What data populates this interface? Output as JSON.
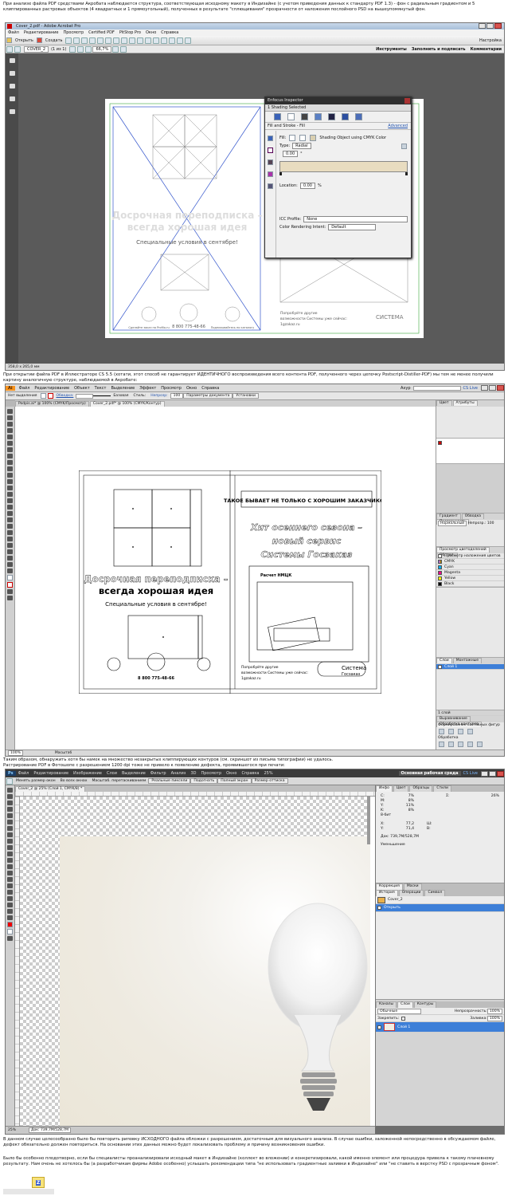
{
  "intro_text": "При анализе файла PDF средствами Акробата наблюдается структура, соответствующая исходному макету в Индизайне (с учетом приведения данных к стандарту PDF 1.3) - фон с радиальным градиентом и 5 клиппированных растровых объектов (4 квадратных и 1 прямоугольный), полученных в результате \"сплющивания\" прозрачности от наложения послойного PSD на вышеупомянутый фон.",
  "acrobat": {
    "title": "Cover_2.pdf - Adobe Acrobat Pro",
    "menu": [
      "Файл",
      "Редактирование",
      "Просмотр",
      "Certified PDF",
      "PitStop Pro",
      "Окно",
      "Справка"
    ],
    "toolbar": {
      "open": "Открыть",
      "create": "Создать",
      "settings": "Настройка"
    },
    "nav": {
      "page_field": "COVER_2",
      "page_count": "(1 из 1)",
      "zoom": "66,7%"
    },
    "right_tabs": [
      "Инструменты",
      "Заполнить и подписать",
      "Комментарии"
    ],
    "status": "358,0 x 265,0 мм",
    "doc": {
      "headline_1": "Досрочная переподписка –",
      "headline_2": "всегда хорошая идея",
      "subheadline": "Специальные условия в сентябре!",
      "site": "Сделайте заказ на Profilo.ru",
      "phone": "8 800 775-48-66",
      "phone_note": "Звонок на все бесплатно оформим",
      "subscription": "Подписывайтесь по каталогу",
      "right_text_1": "Попробуйте другие",
      "right_text_2": "возможности Системы уже сейчас:",
      "right_text_3": "1gzakaz.ru",
      "logo": "СИСТЕМА"
    },
    "inspector": {
      "title": "Enfocus Inspector",
      "selected": "1 Shading Selected",
      "section": "Fill and Stroke - Fill",
      "advanced": "Advanced",
      "fill_label": "Fill:",
      "shading_label": "Shading Object using CMYK Color",
      "type_label": "Type:",
      "type_value": "Radial",
      "angle_value": "0.00",
      "angle_unit": "°",
      "location_label": "Location:",
      "location_value": "0.00",
      "location_unit": "%",
      "icc_label": "ICC Profile:",
      "icc_value": "None",
      "intent_label": "Color Rendering Intent:",
      "intent_value": "Default"
    }
  },
  "illustrator_text": "При открытии файла PDF в Иллюстраторе CS 5.5 (хотати, этот способ не гарантирует ИДЕНТИЧНОГО воспроизведения всего контента PDF, полученного через цепочку Postscript-Distiller-PDF) мы тем не менее получили картину аналогичную структуре, наблюдаемой в Акробате:",
  "illustrator": {
    "app_label": "Ai",
    "menu": [
      "Файл",
      "Редактирование",
      "Объект",
      "Текст",
      "Выделение",
      "Эффект",
      "Просмотр",
      "Окно",
      "Справка"
    ],
    "control_bar": {
      "label": "Нет выделения",
      "stroke_label": "Обводка:",
      "basic": "Базовая",
      "opacity_label": "Стиль:",
      "opacity_field": "Непрозр:",
      "opacity_value": "100",
      "doc_setup": "Параметры документа",
      "prefs": "Установки"
    },
    "workspace": "Ахур",
    "cslive": "CS Live",
    "doc_tabs": [
      "Podpis.ai* @ 100% (CMYK/Просмотр)",
      "Cover_2.pdf* @ 100% (CMYK/Контур)"
    ],
    "zoom": "100%",
    "status": "Масштаб",
    "doc": {
      "banner": "ТАКОЕ БЫВАЕТ НЕ ТОЛЬКО С ХОРОШИМ ЗАКАЗЧИКОМ",
      "hit_1": "Хит осеннего сезона –",
      "hit_2": "новый сервис",
      "hit_3": "Системы Госзаказ",
      "headline_1": "Досрочная переподписка –",
      "headline_2": "всегда хорошая идея",
      "subheadline": "Специальные условия в сентябре!",
      "form_title": "Расчет НМЦК",
      "phone": "8 800 775-48-66",
      "try_1": "Попробуйте другие",
      "try_2": "возможности Системы уже сейчас:",
      "try_3": "1gzakaz.ru",
      "logo_1": "Система",
      "logo_2": "Госзаказ"
    },
    "panels": {
      "attr_tabs": [
        "Цвет",
        "Атрибуты"
      ],
      "transparency_tabs": [
        "Градиент",
        "Обводка",
        "Прозрачность"
      ],
      "blend_mode": "Нормальный",
      "opacity": "Непрозр.: 100",
      "sep_tabs": [
        "Просмотр цветоделений",
        "Об. тел."
      ],
      "sep_check": "Просмотр наложения цветов",
      "sep_rows": [
        "CMYK",
        "Cyan",
        "Magenta",
        "Yellow",
        "Black"
      ],
      "layers_tabs": [
        "Слои",
        "Монтажные"
      ],
      "layer_name": "Слой 1",
      "layers_count": "1 слой",
      "pathfinder_tabs": [
        "Выравнивание",
        "Обработка контуров"
      ],
      "pathfinder_label_1": "Формирование составных фигур",
      "pathfinder_label_2": "Обработка"
    }
  },
  "photoshop_text_1": "Таким образом, обнаружить хотя бы намек на множество незакрытых клиппирующих контуров (см. скриншот из письма типографии) не удалось.",
  "photoshop_text_2": "Растрирование PDF в Фотошопе с разрешением 1200 dpi тоже не привело к появлению дефекта, проявившегося при печати:",
  "photoshop": {
    "app_label": "Ps",
    "menu": [
      "Файл",
      "Редактирование",
      "Изображение",
      "Слои",
      "Выделение",
      "Фильтр",
      "Анализ",
      "3D",
      "Просмотр",
      "Окно",
      "Справка"
    ],
    "zoom_menu": "25%",
    "workspace": "Основная рабочая среда",
    "cslive": "CS Live",
    "options": [
      "Менять размер окон",
      "Во всех окнах",
      "Масштаб. перетаскиванием",
      "Реальные пиксели",
      "Подогнать",
      "Полный экран",
      "Размер оттиска"
    ],
    "doc_tab": "Cover_2 @ 25% (Слой 1, CMYK/8) *",
    "status_zoom": "25%",
    "status_doc": "Док: 739,7М/528,7М",
    "info": {
      "tabs": [
        "Инфо",
        "Цвет",
        "Образцы",
        "Стили"
      ],
      "c": "7%",
      "m": "8%",
      "y": "11%",
      "k": "8%",
      "bit": "8-бит",
      "x": "77,2",
      "y_coord": "71,4",
      "w_label": "Ш:",
      "h_label": "В:",
      "doc": "Док: 739,7М/528,7М",
      "note": "Уменьшение",
      "sigma": "26%"
    },
    "adjust_tabs": [
      "Коррекция",
      "Маски"
    ],
    "history_tabs": [
      "История",
      "Операции",
      "Символ"
    ],
    "history_items": [
      "Cover_2",
      "Открыть"
    ],
    "layers": {
      "tabs": [
        "Каналы",
        "Слои",
        "Контуры"
      ],
      "blend": "Обычные",
      "opacity_label": "Непрозрачность:",
      "opacity": "100%",
      "lock_label": "Закрепить:",
      "fill_label": "Заливка:",
      "fill": "100%",
      "layer_name": "Слой 1"
    }
  },
  "conclusion_text_1": "В данном случае целесообразно было бы повторить риповку ИСХОДНОГО файла обложки с разрешением, достаточным для визуального анализа. В случае ошибки, заложенной непосредственно в обсуждаемом файле, дефект обязательно должен повториться. На основании этих данных можно будет локализовать проблему и причину возникновения ошибки.",
  "conclusion_text_2": "Было бы особенно плодотворно, если бы специалисты проанализировали исходный макет в Индизайне (коллект во вложении) и конкретизировали, какой именно элемент или процедура привела к такому плачевному результату. Нам очень не хотелось бы (а разработчикам фирмы Adobe особенно) услышать рекомендации типа \"не использовать градиентные заливки в Индизайне\" или \"не ставить в верстку PSD с прозрачным фоном\".",
  "attachment_icon_label": "Z",
  "colors": {
    "acrobat_bg": "#5a5a5a",
    "inspector_header": "#2f2f2f",
    "ps_dark": "#3a3a3a",
    "ps_accent": "#3d7fd8",
    "ai_panel": "#d4d4d4"
  }
}
